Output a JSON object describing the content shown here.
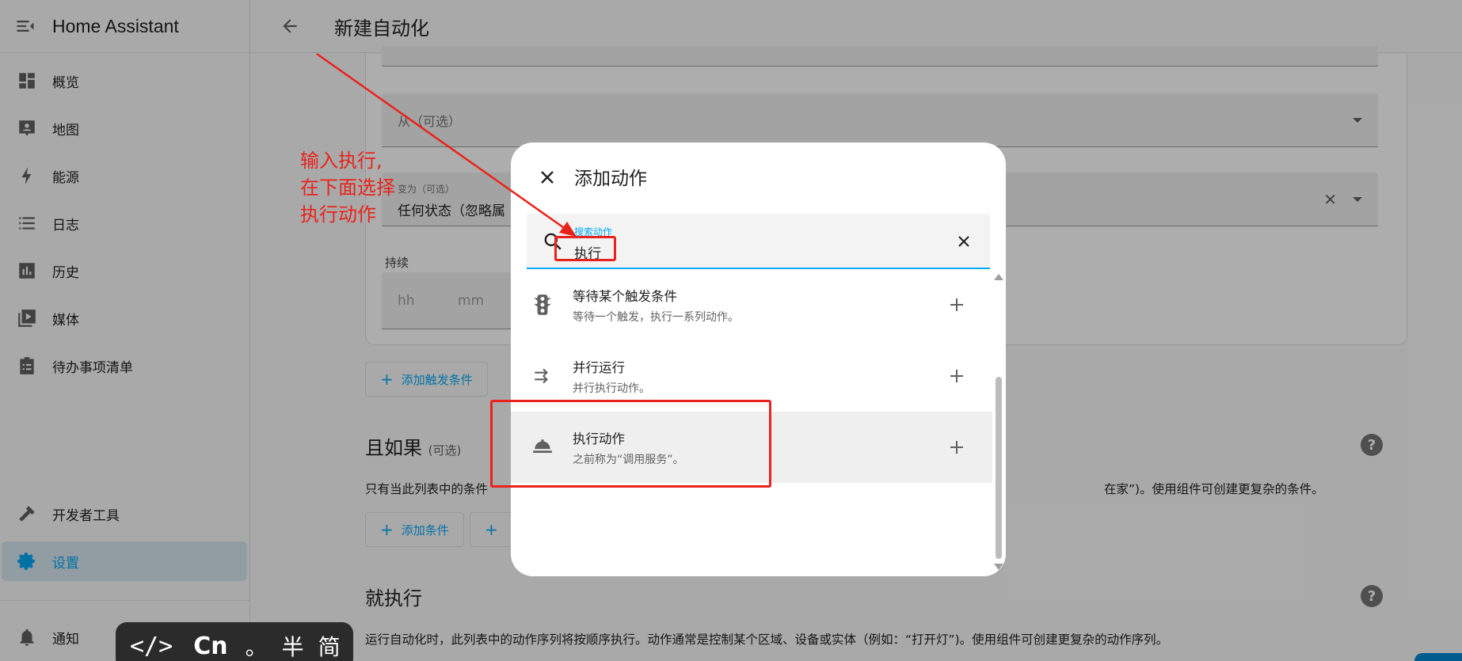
{
  "app": {
    "title": "Home Assistant"
  },
  "sidebar": {
    "items": [
      {
        "label": "概览",
        "icon": "dashboard-icon"
      },
      {
        "label": "地图",
        "icon": "map-icon"
      },
      {
        "label": "能源",
        "icon": "lightning-icon"
      },
      {
        "label": "日志",
        "icon": "logbook-icon"
      },
      {
        "label": "历史",
        "icon": "history-icon"
      },
      {
        "label": "媒体",
        "icon": "media-icon"
      },
      {
        "label": "待办事项清单",
        "icon": "todo-icon"
      }
    ],
    "developer_tools": "开发者工具",
    "settings": "设置",
    "notifications": "通知"
  },
  "topbar": {
    "title": "新建自动化"
  },
  "trigger_card": {
    "from_label": "从（可选）",
    "to_small_label": "变为（可选）",
    "to_value": "任何状态（忽略属",
    "duration_label": "持续",
    "hh": "hh",
    "mm": "mm"
  },
  "add_trigger_button": "添加触发条件",
  "conditions": {
    "title": "且如果",
    "optional": "(可选)",
    "description_start": "只有当此列表中的条件",
    "description_end": "在家”)。使用组件可创建更复杂的条件。",
    "add_condition_button": "添加条件"
  },
  "actions": {
    "title": "就执行",
    "description": "运行自动化时，此列表中的动作序列将按顺序执行。动作通常是控制某个区域、设备或实体（例如：“打开灯”)。使用组件可创建更复杂的动作序列。"
  },
  "dialog": {
    "title": "添加动作",
    "search_label": "搜索动作",
    "search_value": "执行",
    "options": [
      {
        "name": "等待某个触发条件",
        "desc": "等待一个触发，执行一系列动作。",
        "icon": "traffic-light-icon"
      },
      {
        "name": "并行运行",
        "desc": "并行执行动作。",
        "icon": "parallel-arrows-icon"
      },
      {
        "name": "执行动作",
        "desc": "之前称为“调用服务”。",
        "icon": "room-service-icon"
      }
    ]
  },
  "annotation": {
    "line1": "输入执行,",
    "line2": "在下面选择",
    "line3": "执行动作",
    "color": "#e8231d"
  },
  "ime": {
    "code": "</>",
    "cn": "Cn",
    "dot": "。",
    "half": "半",
    "simplified": "简"
  },
  "colors": {
    "accent": "#03a9f4"
  }
}
